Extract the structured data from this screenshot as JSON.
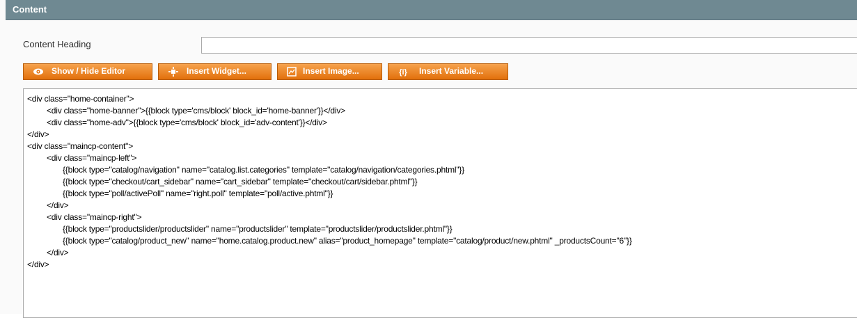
{
  "section": {
    "title": "Content"
  },
  "form": {
    "heading_label": "Content Heading",
    "heading_value": ""
  },
  "toolbar": {
    "buttons": [
      {
        "label": "Show / Hide Editor",
        "icon": "eye-icon"
      },
      {
        "label": "Insert Widget...",
        "icon": "widget-icon"
      },
      {
        "label": "Insert Image...",
        "icon": "image-icon"
      },
      {
        "label": "Insert Variable...",
        "icon": "variable-icon"
      }
    ]
  },
  "editor": {
    "lines": [
      "<div class=\"home-container\">",
      "<div class=\"home-banner\">{{block type='cms/block' block_id='home-banner'}}</div>",
      "<div class=\"home-adv\">{{block type='cms/block' block_id='adv-content'}}</div>",
      "</div>",
      "<div class=\"maincp-content\">",
      "<div class=\"maincp-left\">",
      "{{block type=\"catalog/navigation\" name=\"catalog.list.categories\" template=\"catalog/navigation/categories.phtml\"}}",
      "{{block type=\"checkout/cart_sidebar\" name=\"cart_sidebar\" template=\"checkout/cart/sidebar.phtml\"}}",
      "{{block type=\"poll/activePoll\" name=\"right.poll\" template=\"poll/active.phtml\"}}",
      "</div>",
      "<div class=\"maincp-right\">",
      "{{block type=\"productslider/productslider\" name=\"productslider\" template=\"productslider/productslider.phtml\"}}",
      "{{block type=\"catalog/product_new\" name=\"home.catalog.product.new\" alias=\"product_homepage\" template=\"catalog/product/new.phtml\" _productsCount=\"6\"}}",
      "</div>",
      "</div>"
    ]
  },
  "colors": {
    "header_bg": "#6f8992",
    "button_orange": "#e2700c"
  }
}
